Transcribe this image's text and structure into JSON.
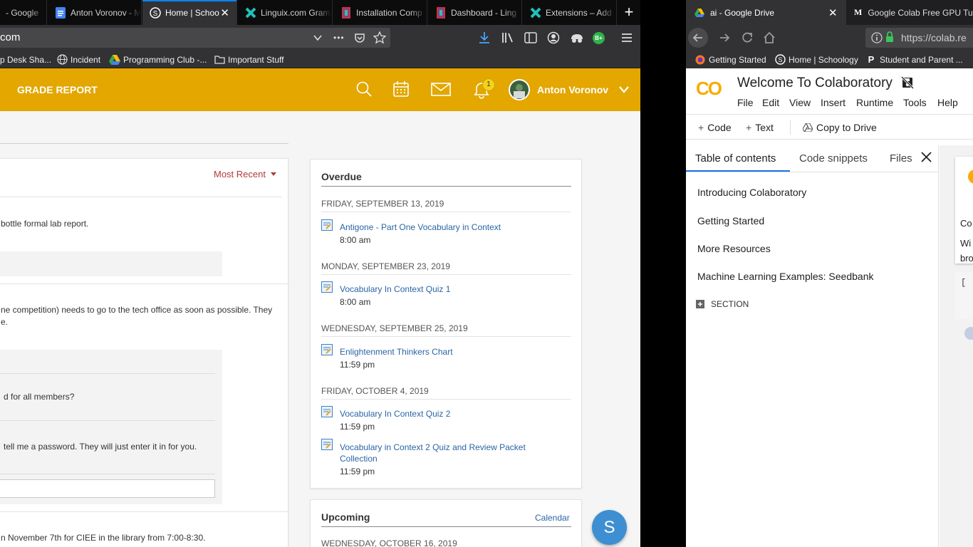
{
  "left_browser": {
    "tabs": [
      {
        "label": "- Google",
        "active": false
      },
      {
        "label": "Anton Voronov - M",
        "active": false
      },
      {
        "label": "Home | Schoo",
        "active": true
      },
      {
        "label": "Linguix.com Gram",
        "active": false
      },
      {
        "label": "Installation Comp",
        "active": false
      },
      {
        "label": "Dashboard - Ling",
        "active": false
      },
      {
        "label": "Extensions – Add",
        "active": false
      }
    ],
    "new_tab_symbol": "+",
    "tab_close_symbol": "✕",
    "url_text": "com",
    "menu_dots": "•••",
    "ext_badge": "B+",
    "bookmarks": [
      "p Desk Sha...",
      "Incident",
      "Programming Club -...",
      "Important Stuff"
    ]
  },
  "schoology": {
    "header_title": "GRADE REPORT",
    "notification_count": "1",
    "user_name": "Anton Voronov",
    "sort_label": "Most Recent",
    "feed_lines": [
      "bottle formal lab report.",
      "ne competition) needs to go to the tech office as soon as possible. They",
      "e.",
      "d for all members?",
      "tell me a password. They will just enter it in for you.",
      "n November 7th for CIEE in the library from 7:00-8:30."
    ],
    "overdue": {
      "title": "Overdue",
      "groups": [
        {
          "date": "FRIDAY, SEPTEMBER 13, 2019",
          "items": [
            {
              "title": "Antigone - Part One Vocabulary in Context",
              "time": "8:00 am"
            }
          ]
        },
        {
          "date": "MONDAY, SEPTEMBER 23, 2019",
          "items": [
            {
              "title": "Vocabulary In Context Quiz 1",
              "time": "8:00 am"
            }
          ]
        },
        {
          "date": "WEDNESDAY, SEPTEMBER 25, 2019",
          "items": [
            {
              "title": "Enlightenment Thinkers Chart",
              "time": "11:59 pm"
            }
          ]
        },
        {
          "date": "FRIDAY, OCTOBER 4, 2019",
          "items": [
            {
              "title": "Vocabulary In Context Quiz 2",
              "time": "11:59 pm"
            },
            {
              "title_line1": "Vocabulary in Context 2 Quiz and Review Packet",
              "title_line2": "Collection",
              "time": "11:59 pm"
            }
          ]
        }
      ]
    },
    "upcoming": {
      "title": "Upcoming",
      "calendar_link": "Calendar",
      "first_date": "WEDNESDAY, OCTOBER 16, 2019"
    },
    "fab_letter": "S",
    "colors": {
      "header": "#e3a700",
      "link": "#2b65a3",
      "sort": "#b03a3a",
      "fab": "#3d8fd1"
    }
  },
  "right_browser": {
    "tabs": [
      {
        "label": "ai - Google Drive",
        "active": true
      },
      {
        "label": "Google Colab Free GPU Tuto",
        "active": false
      }
    ],
    "tab_close_symbol": "✕",
    "medium_glyph": "M",
    "url_text": "https://colab.re",
    "bookmarks": [
      "Getting Started",
      "Home | Schoology",
      "Student and Parent ..."
    ],
    "schoology_glyph": "S",
    "parent_glyph": "P"
  },
  "colab": {
    "logo_text": "CO",
    "title": "Welcome To Colaboratory",
    "menu": [
      "File",
      "Edit",
      "View",
      "Insert",
      "Runtime",
      "Tools",
      "Help"
    ],
    "toolbar": {
      "code": "Code",
      "text": "Text",
      "copy": "Copy to Drive"
    },
    "panel_tabs": [
      "Table of contents",
      "Code snippets",
      "Files"
    ],
    "panel_close": "✕",
    "toc": [
      "Introducing Colaboratory",
      "Getting Started",
      "More Resources",
      "Machine Learning Examples: Seedbank"
    ],
    "section_label": "SECTION",
    "cell_peek": [
      "Co",
      "Wi",
      "bro",
      "["
    ],
    "colors": {
      "logo": "#f9ab00",
      "active_tab": "#1a73e8"
    }
  }
}
